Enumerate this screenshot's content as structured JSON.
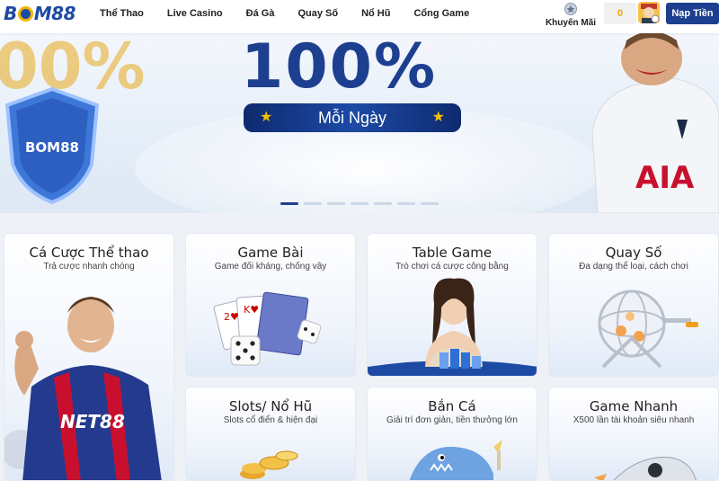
{
  "header": {
    "logo_text_1": "B",
    "logo_text_2": "M88",
    "nav": [
      "Thể Thao",
      "Live Casino",
      "Đá Gà",
      "Quay Số",
      "Nổ Hũ",
      "Cổng Game"
    ],
    "promo_label": "Khuyến Mãi",
    "balance": "0",
    "deposit_label": "Nạp Tiền"
  },
  "banner": {
    "headline": "100%",
    "pill_text": "Mỗi Ngày",
    "left_gold_text": "00%",
    "shield_logo": "BOM88",
    "jersey_text": "AIA",
    "slide_count": 7,
    "active_slide": 1
  },
  "categories": [
    {
      "title": "Cá Cược Thể thao",
      "subtitle": "Trả cược nhanh chóng",
      "jersey_text": "NET88"
    },
    {
      "title": "Game Bài",
      "subtitle": "Game đối kháng, chống vây"
    },
    {
      "title": "Table Game",
      "subtitle": "Trò chơi cá cược công bằng"
    },
    {
      "title": "Quay Số",
      "subtitle": "Đa dạng thể loại, cách chơi"
    },
    {
      "title": "Slots/ Nổ Hũ",
      "subtitle": "Slots cổ điển & hiện đại"
    },
    {
      "title": "Bắn Cá",
      "subtitle": "Giải trí đơn giản, tiền thưởng lớn"
    },
    {
      "title": "Game Nhanh",
      "subtitle": "X500 lần tài khoản siêu nhanh"
    }
  ],
  "colors": {
    "brand_blue": "#1d3f8f",
    "brand_gold": "#f0b400",
    "balance_gold": "#f3a500"
  },
  "icons": [
    "promo-medal-icon",
    "avatar-icon"
  ]
}
